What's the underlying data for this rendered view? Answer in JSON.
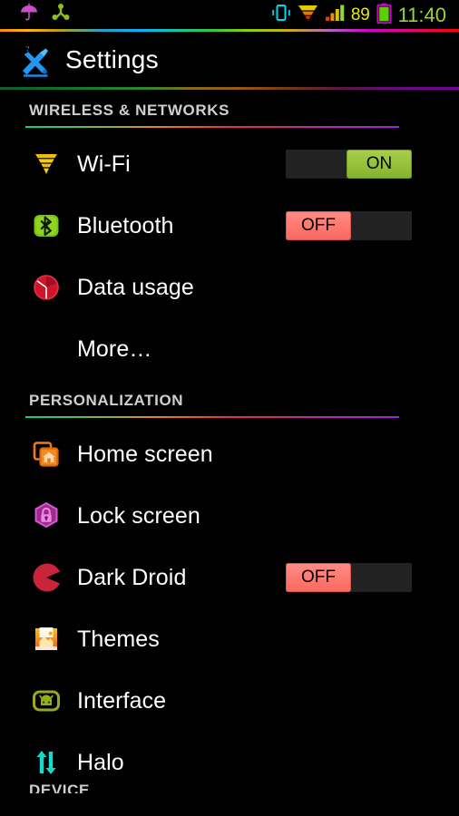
{
  "status_bar": {
    "left_icons": [
      {
        "name": "umbrella-icon",
        "color": "#c850c8"
      },
      {
        "name": "bluetooth-share-icon",
        "color": "#8fc014"
      }
    ],
    "right_icons": [
      {
        "name": "vibrate-icon",
        "color": "#00d8f0"
      },
      {
        "name": "wifi-icon",
        "color": "#e8c800"
      },
      {
        "name": "signal-bars-icon",
        "color": "#9ad81e"
      }
    ],
    "battery_percent": "89",
    "battery_icon": "battery-icon",
    "time": "11:40"
  },
  "title_bar": {
    "icon": "settings-tools-icon",
    "title": "Settings"
  },
  "sections": [
    {
      "header": "WIRELESS & NETWORKS",
      "rows": [
        {
          "label": "Wi-Fi",
          "icon": "wifi-icon",
          "toggle": "ON"
        },
        {
          "label": "Bluetooth",
          "icon": "bluetooth-icon",
          "toggle": "OFF"
        },
        {
          "label": "Data usage",
          "icon": "data-usage-icon",
          "toggle": null
        },
        {
          "label": "More…",
          "icon": null,
          "toggle": null
        }
      ]
    },
    {
      "header": "PERSONALIZATION",
      "rows": [
        {
          "label": "Home screen",
          "icon": "home-screen-icon",
          "toggle": null
        },
        {
          "label": "Lock screen",
          "icon": "lock-screen-icon",
          "toggle": null
        },
        {
          "label": "Dark Droid",
          "icon": "dark-droid-icon",
          "toggle": "OFF"
        },
        {
          "label": "Themes",
          "icon": "themes-icon",
          "toggle": null
        },
        {
          "label": "Interface",
          "icon": "interface-icon",
          "toggle": null
        },
        {
          "label": "Halo",
          "icon": "halo-icon",
          "toggle": null
        }
      ]
    }
  ],
  "cut_off_header": "DEVICE",
  "colors": {
    "background": "#000000",
    "label_text": "#ffffff",
    "header_text": "#cfcfcf",
    "toggle_on": "#97c23a",
    "toggle_off": "#fd7a72",
    "toggle_track": "#222222",
    "clock": "#9ad81e",
    "battery_text": "#e8e80f"
  }
}
